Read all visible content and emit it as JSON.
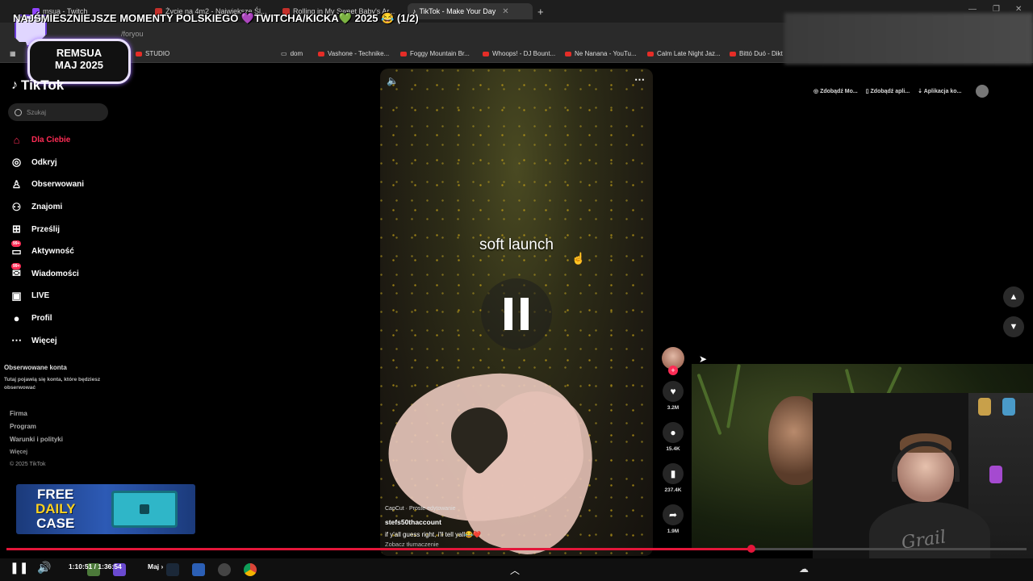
{
  "browser": {
    "tabs": [
      {
        "label": "msua - Twitch"
      },
      {
        "label": "Życie na 4m2 - Największe Śl..."
      },
      {
        "label": "Rolling in My Sweet Baby's Ar..."
      },
      {
        "label": "TikTok - Make Your Day"
      }
    ],
    "url": "/foryou",
    "bookmarks": [
      "STUDIO",
      "dom",
      "Vashone - Technike...",
      "Foggy Mountain Br...",
      "Whoops! - DJ Bount...",
      "Ne Nanana - YouTu...",
      "Calm Late Night Jaz...",
      "Bittó Duó - Dikt"
    ]
  },
  "overlay": {
    "title": "NAJŚMIESZNIEJSZE MOMENTY POLSKIEGO 💜TWITCHA/KICKA💚 2025 😂 (1/2)",
    "badge_line1": "REMSUA",
    "badge_line2": "MAJ 2025"
  },
  "sidebar": {
    "logo": "TikTok",
    "search_placeholder": "Szukaj",
    "nav": [
      {
        "label": "Dla Ciebie",
        "icon": "home-icon"
      },
      {
        "label": "Odkryj",
        "icon": "compass-icon"
      },
      {
        "label": "Obserwowani",
        "icon": "following-icon"
      },
      {
        "label": "Znajomi",
        "icon": "friends-icon"
      },
      {
        "label": "Prześlij",
        "icon": "upload-icon"
      },
      {
        "label": "Aktywność",
        "icon": "activity-icon",
        "badge": "99+"
      },
      {
        "label": "Wiadomości",
        "icon": "messages-icon",
        "badge": "99+"
      },
      {
        "label": "LIVE",
        "icon": "live-icon"
      },
      {
        "label": "Profil",
        "icon": "profile-icon"
      },
      {
        "label": "Więcej",
        "icon": "more-icon"
      }
    ],
    "followed_heading": "Obserwowane konta",
    "followed_desc": "Tutaj pojawią się konta, które będziesz obserwować",
    "footer": [
      "Firma",
      "Program",
      "Warunki i polityki"
    ],
    "footer_more": "Więcej",
    "copyright": "© 2025 TikTok",
    "ad_line1": "FREE",
    "ad_line2": "DAILY",
    "ad_line3": "CASE"
  },
  "top_actions": [
    "Zdobądź Mo...",
    "Zdobądź apli...",
    "Aplikacja ko..."
  ],
  "video": {
    "caption": "soft launch",
    "capcut": "CapCut · Proste edytowanie",
    "username": "stefs50thaccount",
    "description": "if y'all guess right, i'll tell yall😂❤️",
    "translate": "Zobacz tłumaczenie"
  },
  "actions": {
    "likes": "3.2M",
    "comments": "15.4K",
    "saves": "237.4K",
    "shares": "1.9M"
  },
  "player": {
    "time": "1:10:51 / 1:36:54",
    "chapter": "Maj",
    "progress": 0.73
  },
  "cam": {
    "shirt_text": "Grail"
  }
}
